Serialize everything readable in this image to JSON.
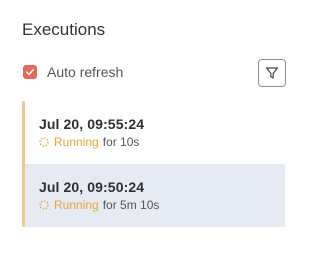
{
  "panel": {
    "title": "Executions"
  },
  "auto_refresh": {
    "label": "Auto refresh",
    "checked": true
  },
  "filter": {
    "icon": "filter-icon"
  },
  "executions": [
    {
      "time": "Jul 20, 09:55:24",
      "status": "Running",
      "duration": "for 10s",
      "selected": false
    },
    {
      "time": "Jul 20, 09:50:24",
      "status": "Running",
      "duration": "for 5m 10s",
      "selected": true
    }
  ],
  "colors": {
    "accent": "#e8685a",
    "running": "#e7a43a",
    "item_border": "#f0c98a",
    "selected_bg": "#e6eaf3"
  }
}
